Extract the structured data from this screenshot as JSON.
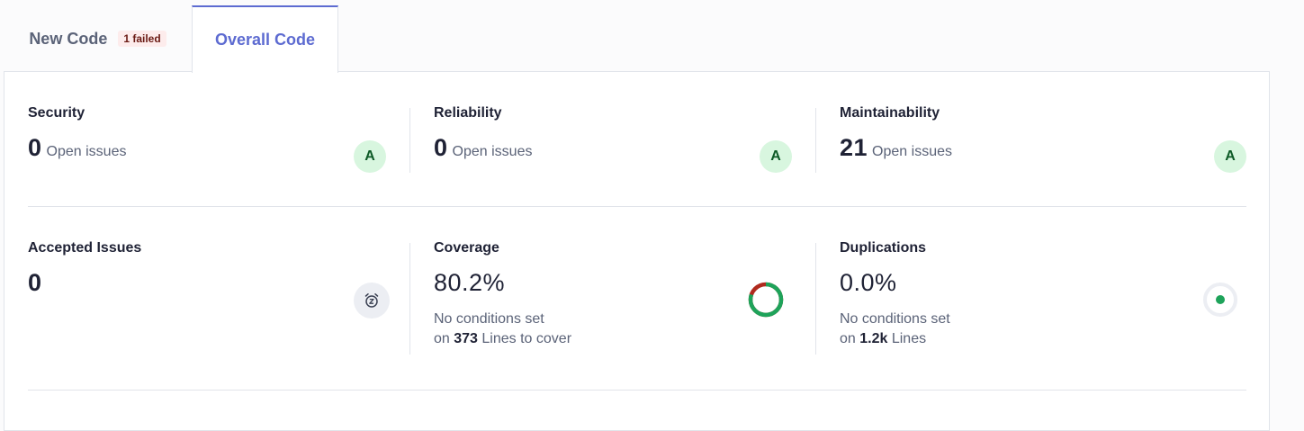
{
  "tabs": {
    "new_code": {
      "label": "New Code",
      "badge": "1 failed"
    },
    "overall_code": {
      "label": "Overall Code"
    }
  },
  "metrics": {
    "security": {
      "label": "Security",
      "value": "0",
      "sub": "Open issues",
      "grade": "A"
    },
    "reliability": {
      "label": "Reliability",
      "value": "0",
      "sub": "Open issues",
      "grade": "A"
    },
    "maintainability": {
      "label": "Maintainability",
      "value": "21",
      "sub": "Open issues",
      "grade": "A"
    },
    "accepted": {
      "label": "Accepted Issues",
      "value": "0"
    },
    "coverage": {
      "label": "Coverage",
      "value": "80.2%",
      "note_line1": "No conditions set",
      "note_prefix": "on",
      "note_count": "373",
      "note_suffix": "Lines to cover",
      "percent": 80.2
    },
    "duplications": {
      "label": "Duplications",
      "value": "0.0%",
      "note_line1": "No conditions set",
      "note_prefix": "on",
      "note_count": "1.2k",
      "note_suffix": "Lines",
      "percent": 0.0
    }
  },
  "colors": {
    "accent": "#5d6bd1",
    "grade_bg": "#d8f6df",
    "coverage_good": "#1ea35a",
    "coverage_bad": "#b02a1e"
  },
  "icons": {
    "accepted": "alarm-snooze-icon",
    "coverage": "coverage-donut-icon",
    "duplications": "duplications-dot-icon"
  }
}
